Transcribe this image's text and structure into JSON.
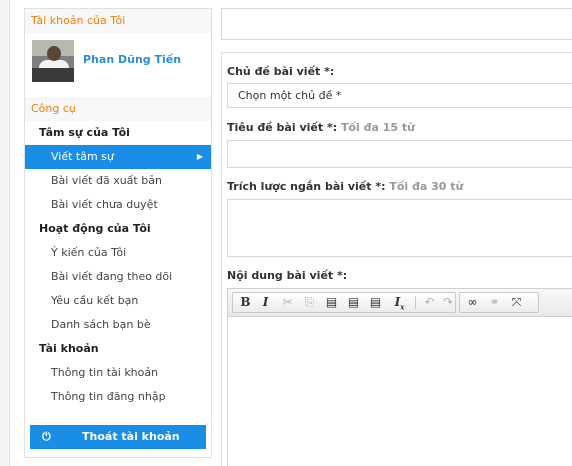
{
  "sidebar": {
    "my_account_title": "Tài khoản của Tôi",
    "profile_name": "Phan Dũng Tiến",
    "tools_title": "Công cụ",
    "groups": [
      {
        "title": "Tâm sự của Tôi",
        "items": [
          "Viết tâm sự",
          "Bài viết đã xuất bản",
          "Bài viết chưa duyệt"
        ]
      },
      {
        "title": "Hoạt động của Tôi",
        "items": [
          "Ý kiến của Tôi",
          "Bài viết đang theo dõi",
          "Yêu cầu kết bạn",
          "Danh sách bạn bè"
        ]
      },
      {
        "title": "Tài khoản",
        "items": [
          "Thông tin tài khoản",
          "Thông tin đăng nhập"
        ]
      }
    ],
    "active_item": "Viết tâm sự",
    "logout_label": "Thoát tài khoản"
  },
  "form": {
    "topic_label": "Chủ đề bài viết *:",
    "topic_value": "Chọn một chủ đề *",
    "title_label": "Tiêu đề bài viết *:",
    "title_hint": "Tối đa 15 từ",
    "summary_label": "Trích lược ngắn bài viết *:",
    "summary_hint": "Tối đa 30 từ",
    "content_label": "Nội dung bài viết *:"
  },
  "editor_toolbar": {
    "bold": "B",
    "italic": "I",
    "icons": [
      "cut-icon",
      "copy-icon",
      "paste-icon",
      "paste-text-icon",
      "paste-word-icon",
      "remove-format-icon",
      "undo-icon",
      "redo-icon",
      "link-icon",
      "unlink-icon",
      "maximize-icon"
    ]
  },
  "colors": {
    "accent": "#1a8ee6",
    "section_title": "#e8820c",
    "profile_name": "#2b8fd6"
  }
}
